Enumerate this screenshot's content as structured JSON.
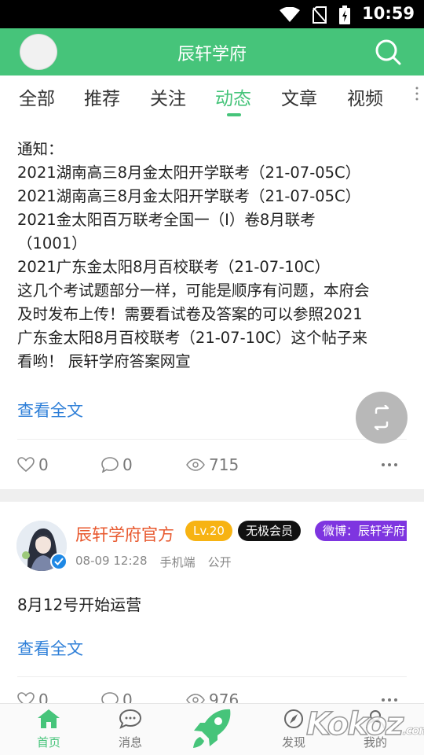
{
  "status_bar": {
    "time": "10:59",
    "icons": [
      "wifi-icon",
      "no-sim-icon",
      "battery-charging-icon"
    ]
  },
  "app_bar": {
    "title": "辰轩学府",
    "search_icon": "search-icon"
  },
  "tabs": [
    {
      "label": "全部",
      "active": false
    },
    {
      "label": "推荐",
      "active": false
    },
    {
      "label": "关注",
      "active": false
    },
    {
      "label": "动态",
      "active": true
    },
    {
      "label": "文章",
      "active": false
    },
    {
      "label": "视频",
      "active": false
    }
  ],
  "colors": {
    "primary": "#46c47a",
    "link": "#2e7fd8",
    "username": "#e8592f",
    "level_badge": "#f7b313",
    "weibo_badge": "#7e35e0"
  },
  "post1": {
    "lines": [
      "通知：",
      "2021湖南高三8月金太阳开学联考（21-07-05C）",
      "2021湖南高三8月金太阳开学联考（21-07-05C）",
      "2021金太阳百万联考全国一（I）卷8月联考",
      "（1001）",
      "2021广东金太阳8月百校联考（21-07-10C）",
      "这几个考试题部分一样，可能是顺序有问题，本府会",
      "及时发布上传！需要看试卷及答案的可以参照2021",
      "广东金太阳8月百校联考（21-07-10C）这个帖子来",
      "看哟！ 辰轩学府答案网宣"
    ],
    "read_more": "查看全文",
    "likes": "0",
    "comments": "0",
    "views": "715"
  },
  "post2": {
    "author": "辰轩学府官方",
    "level": "Lv.20",
    "vip_badge": "无极会员",
    "weibo_badge": "微博：辰轩学府",
    "time": "08-09 12:28",
    "device": "手机端",
    "visibility": "公开",
    "text": "8月12号开始运营",
    "read_more": "查看全文",
    "likes": "0",
    "comments": "0",
    "views": "976"
  },
  "bottom_nav": [
    {
      "label": "首页",
      "icon": "home-icon",
      "active": true
    },
    {
      "label": "消息",
      "icon": "message-icon",
      "active": false
    },
    {
      "label": "",
      "icon": "rocket-icon",
      "active": false
    },
    {
      "label": "发现",
      "icon": "compass-icon",
      "active": false
    },
    {
      "label": "我的",
      "icon": "profile-icon",
      "active": false
    }
  ],
  "watermark": {
    "text": "Kokoz",
    "suffix": ".com"
  }
}
